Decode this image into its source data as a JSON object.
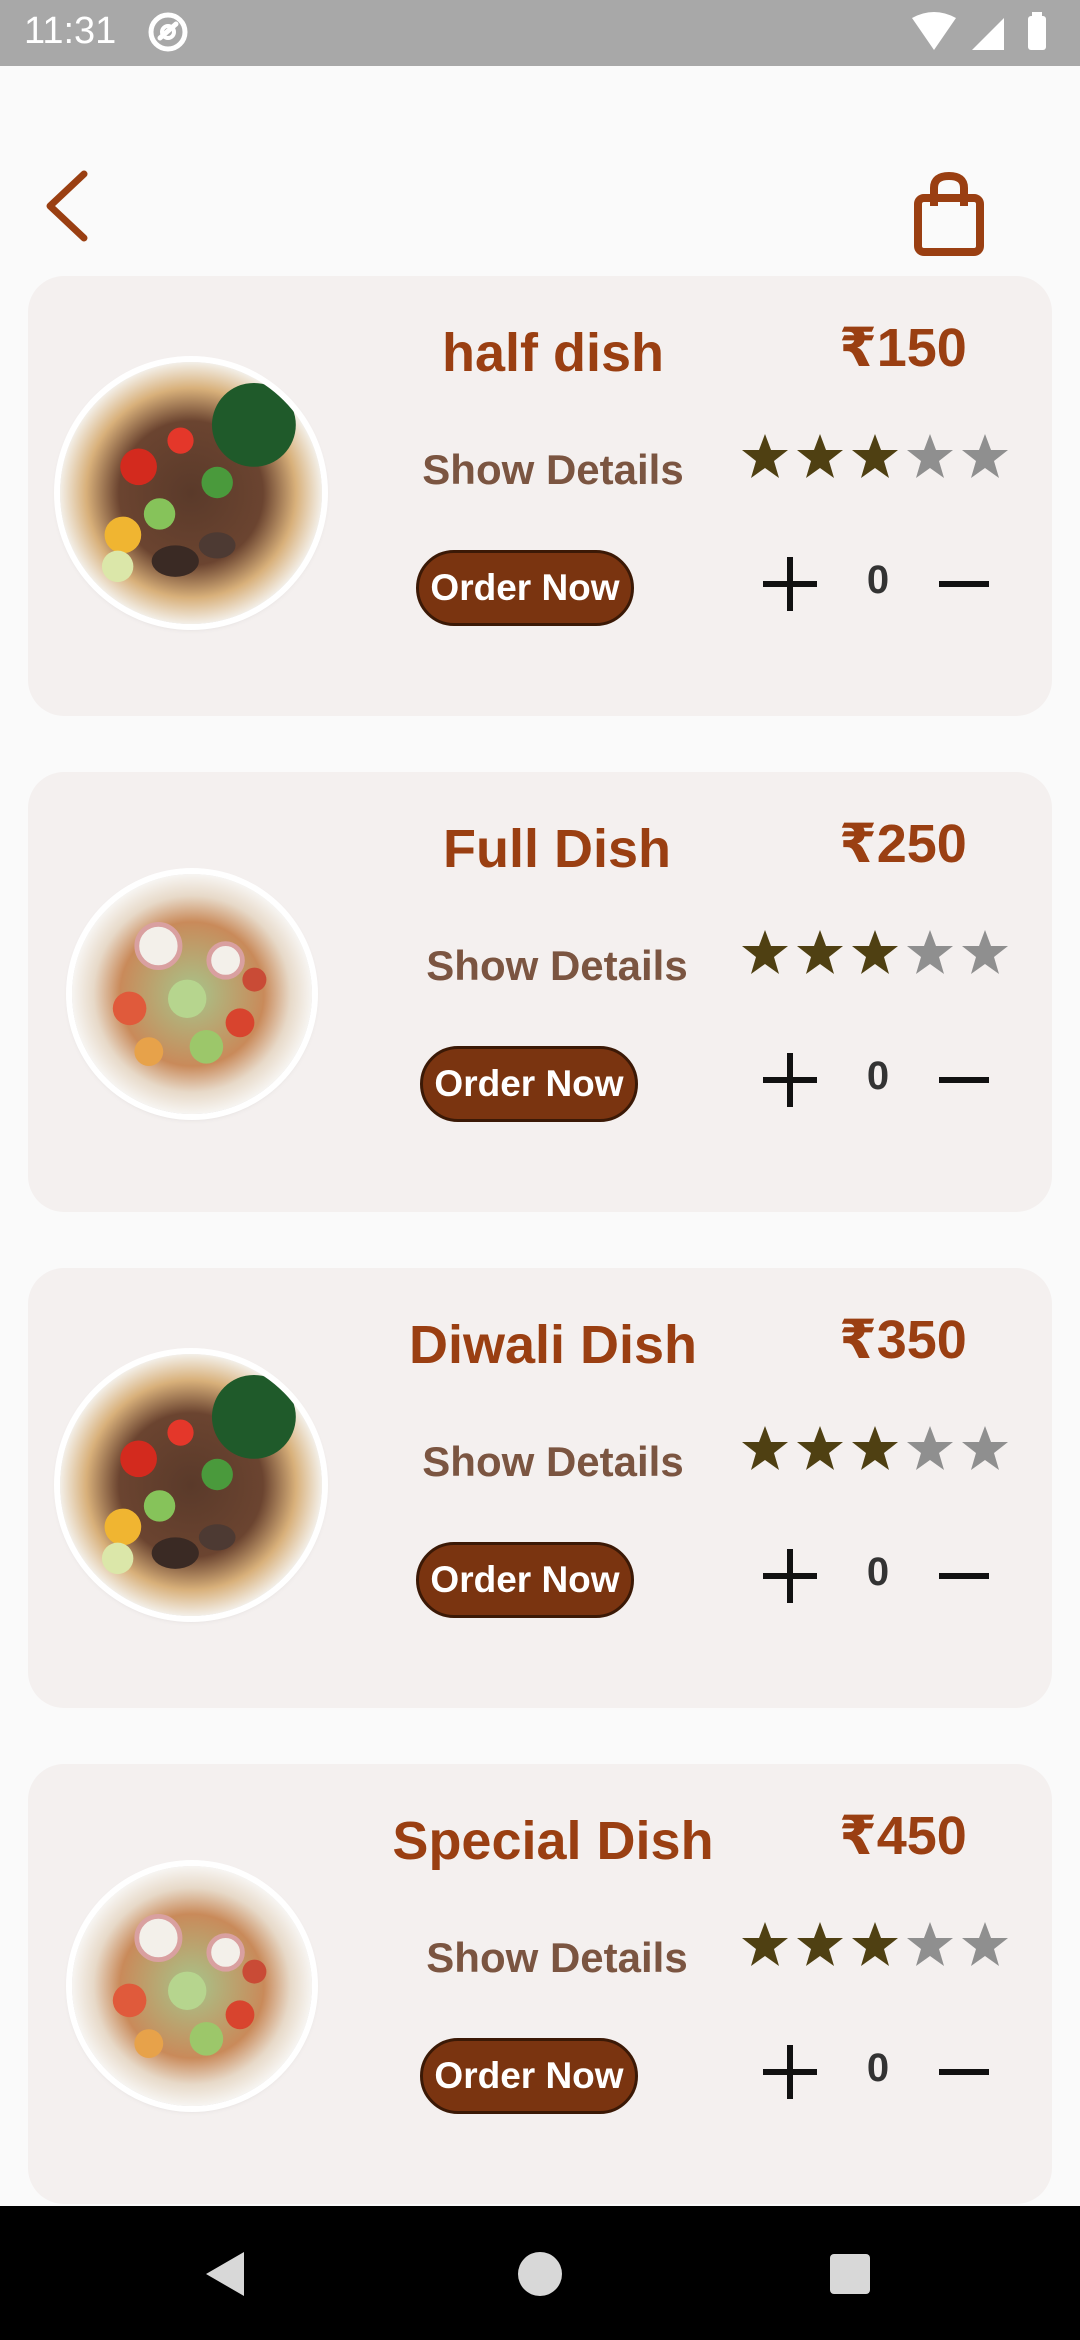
{
  "status_bar": {
    "time": "11:31"
  },
  "icons": {
    "back": "chevron-left-icon",
    "cart": "shopping-bag-icon",
    "star": "star-icon",
    "plus": "plus-icon",
    "minus": "minus-icon"
  },
  "colors": {
    "accent": "#9a3f12",
    "button_fill": "#7a3410",
    "star_filled": "#4f4012",
    "star_empty": "#8f8f8f",
    "card_bg": "#f4f0ef"
  },
  "dishes": [
    {
      "name": "half dish",
      "price": "₹150",
      "details_label": "Show Details",
      "order_label": "Order Now",
      "rating": 3,
      "rating_max": 5,
      "quantity": "0"
    },
    {
      "name": "Full Dish",
      "price": "₹250",
      "details_label": "Show Details",
      "order_label": "Order Now",
      "rating": 3,
      "rating_max": 5,
      "quantity": "0"
    },
    {
      "name": "Diwali Dish",
      "price": "₹350",
      "details_label": "Show Details",
      "order_label": "Order Now",
      "rating": 3,
      "rating_max": 5,
      "quantity": "0"
    },
    {
      "name": "Special Dish",
      "price": "₹450",
      "details_label": "Show Details",
      "order_label": "Order Now",
      "rating": 3,
      "rating_max": 5,
      "quantity": "0"
    }
  ]
}
